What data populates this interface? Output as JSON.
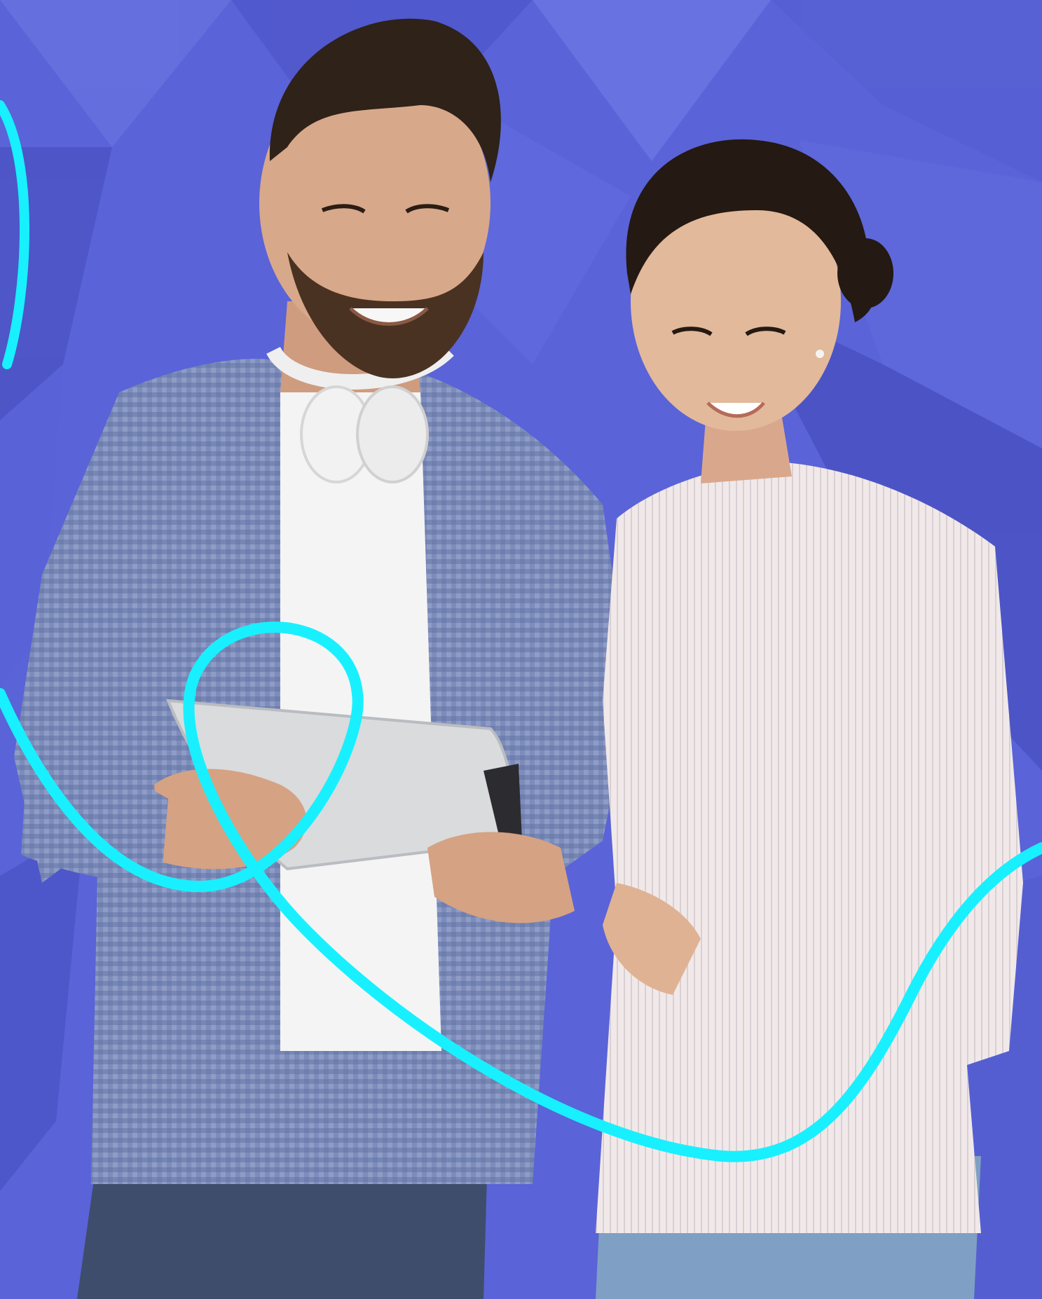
{
  "image": {
    "subject": "two-people-looking-at-tablet",
    "colors": {
      "background": "#5a63d8",
      "background_dark": "#4a52c4",
      "background_light": "#6c75e4",
      "accent_line": "#18f0ff",
      "man_shirt": "#7b8bb8",
      "man_tshirt": "#f4f4f4",
      "woman_blouse": "#efe6e6",
      "jeans": "#3e4d6b",
      "tablet": "#d9dbdd",
      "skin_man": "#d8a88a",
      "skin_woman": "#e2b99a",
      "hair": "#2e2219"
    }
  }
}
